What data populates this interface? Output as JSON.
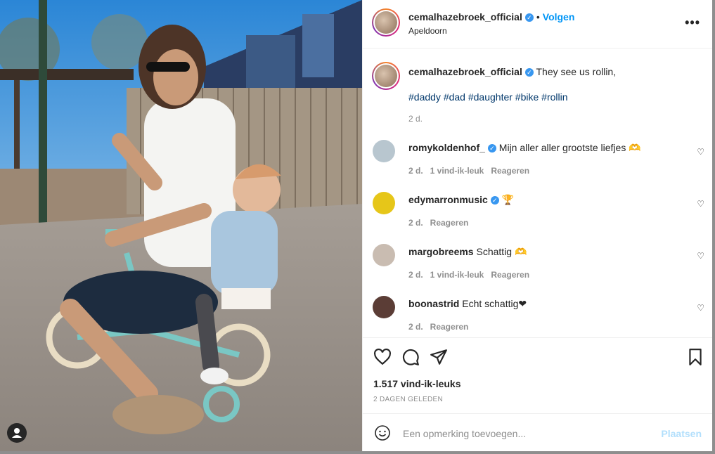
{
  "post": {
    "username": "cemalhazebroek_official",
    "follow_label": "Volgen",
    "location": "Apeldoorn",
    "more_label": "•••",
    "caption_text": "They see us rollin,",
    "hashtags": "#daddy #dad #daughter #bike #rollin",
    "caption_age": "2 d."
  },
  "comments": [
    {
      "username": "romykoldenhof_",
      "verified": true,
      "text": "Mijn aller aller grootste liefjes 🫶",
      "age": "2 d.",
      "likes": "1 vind-ik-leuk",
      "reply": "Reageren",
      "avatar_color": "#b8c6cf"
    },
    {
      "username": "edymarronmusic",
      "verified": true,
      "text": "🏆",
      "age": "2 d.",
      "likes": "",
      "reply": "Reageren",
      "avatar_color": "#e6c619"
    },
    {
      "username": "margobreems",
      "verified": false,
      "text": "Schattig 🫶",
      "age": "2 d.",
      "likes": "1 vind-ik-leuk",
      "reply": "Reageren",
      "avatar_color": "#c9bcb1"
    },
    {
      "username": "boonastrid",
      "verified": false,
      "text": "Echt schattig❤",
      "age": "2 d.",
      "likes": "",
      "reply": "Reageren",
      "avatar_color": "#5b3d36"
    }
  ],
  "stats": {
    "likes": "1.517 vind-ik-leuks",
    "date": "2 DAGEN GELEDEN"
  },
  "comment_box": {
    "placeholder": "Een opmerking toevoegen...",
    "post_label": "Plaatsen"
  },
  "colors": {
    "accent": "#0095f6",
    "verified": "#3897f0",
    "post_disabled": "#b2dffc"
  }
}
